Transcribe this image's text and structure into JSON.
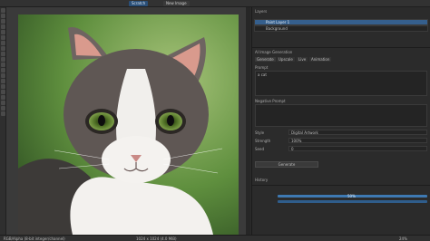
{
  "app": {
    "tabs": [
      "Scratch",
      "New Image"
    ],
    "status_left": "RGB/Alpha (8-bit integer/channel)",
    "status_mid": "1024 x 1024 (4.0 MiB)",
    "zoom": "24%"
  },
  "layers_panel": {
    "header": "Layers",
    "items": [
      {
        "name": "Paint Layer 1",
        "selected": true
      },
      {
        "name": "Background",
        "selected": false
      }
    ]
  },
  "settings_panel": {
    "header": "AI Image Generation",
    "tabs": [
      "Generate",
      "Upscale",
      "Live",
      "Animation"
    ],
    "prompt_label": "Prompt",
    "prompt_value": "a cat",
    "negative_label": "Negative Prompt",
    "fields": [
      {
        "label": "Style",
        "value": "Digital Artwork"
      },
      {
        "label": "Strength",
        "value": "100%"
      },
      {
        "label": "Seed",
        "value": "0"
      }
    ],
    "generate_button": "Generate",
    "history_label": "History",
    "slider_value": "50%"
  },
  "colors": {
    "accent": "#3e79b2",
    "selected_row": "#355f8d",
    "background": "#2b2b2b"
  }
}
